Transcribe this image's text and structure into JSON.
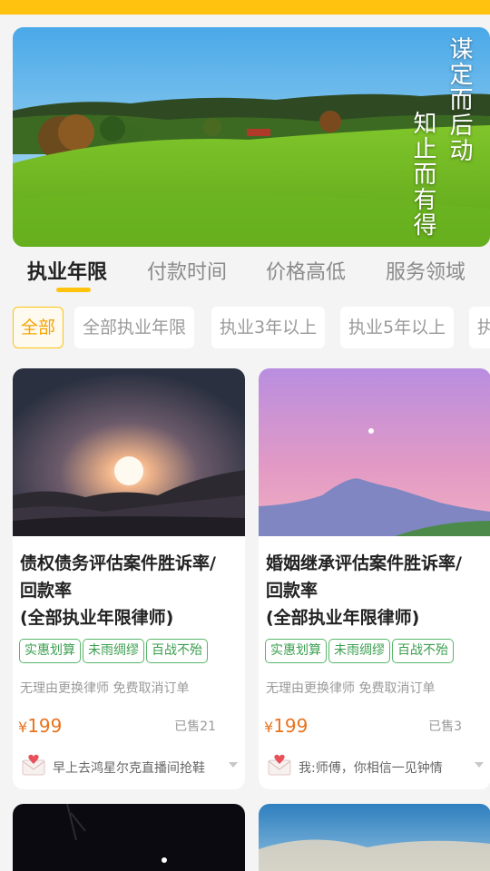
{
  "colors": {
    "accent": "#ffc20e",
    "price": "#e8731e",
    "tag": "#3a9e4e"
  },
  "banner": {
    "line1": "谋定而后动",
    "line2": "知止而有得"
  },
  "tabs": [
    {
      "label": "执业年限",
      "active": true
    },
    {
      "label": "付款时间"
    },
    {
      "label": "价格高低"
    },
    {
      "label": "服务领域"
    }
  ],
  "filters": [
    {
      "label": "全部",
      "active": true
    },
    {
      "label": "全部执业年限"
    },
    {
      "label": "执业3年以上"
    },
    {
      "label": "执业5年以上"
    },
    {
      "label": "执"
    }
  ],
  "cards": [
    {
      "title_line1": "债权债务评估案件胜诉率/",
      "title_line2": "回款率",
      "title_line3": "(全部执业年限律师)",
      "tags": [
        "实惠划算",
        "未雨绸缪",
        "百战不殆"
      ],
      "desc": "无理由更换律师 免费取消订单",
      "price_symbol": "¥",
      "price": "199",
      "sold": "已售21",
      "footer": "早上去鸿星尔克直播间抢鞋",
      "image": "sunset-over-sea"
    },
    {
      "title_line1": "婚姻继承评估案件胜诉率/",
      "title_line2": "回款率",
      "title_line3": "(全部执业年限律师)",
      "tags": [
        "实惠划算",
        "未雨绸缪",
        "百战不殆"
      ],
      "desc": "无理由更换律师 免费取消订单",
      "price_symbol": "¥",
      "price": "199",
      "sold": "已售3",
      "footer": "我:师傅，你相信一见钟情",
      "image": "purple-mountain"
    }
  ]
}
